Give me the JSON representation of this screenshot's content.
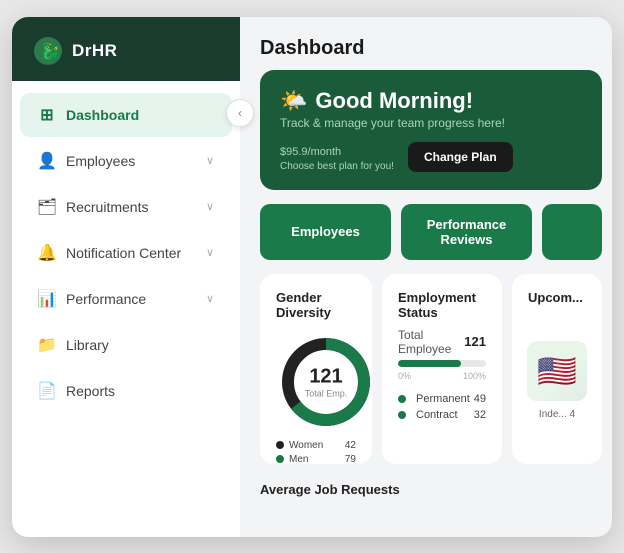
{
  "sidebar": {
    "logo": "DrHR",
    "collapse_icon": "‹",
    "items": [
      {
        "id": "dashboard",
        "label": "Dashboard",
        "icon": "⊞",
        "active": true,
        "hasChevron": false
      },
      {
        "id": "employees",
        "label": "Employees",
        "icon": "👤",
        "active": false,
        "hasChevron": true
      },
      {
        "id": "recruitments",
        "label": "Recruitments",
        "icon": "🗂",
        "active": false,
        "hasChevron": true
      },
      {
        "id": "notification-center",
        "label": "Notification Center",
        "icon": "🔔",
        "active": false,
        "hasChevron": true
      },
      {
        "id": "performance",
        "label": "Performance",
        "icon": "📊",
        "active": false,
        "hasChevron": true
      },
      {
        "id": "library",
        "label": "Library",
        "icon": "📁",
        "active": false,
        "hasChevron": false
      },
      {
        "id": "reports",
        "label": "Reports",
        "icon": "📄",
        "active": false,
        "hasChevron": false
      }
    ]
  },
  "main": {
    "title": "Dashboard",
    "greeting": {
      "emoji": "🌤️",
      "title": "Good Morning!",
      "subtitle": "Track & manage your team progress here!",
      "plan_price": "$95.9",
      "plan_period": "/month",
      "plan_cta": "Choose best plan for you!",
      "change_plan_btn": "Change Plan"
    },
    "quick_actions": [
      {
        "label": "Employees",
        "style": "solid"
      },
      {
        "label": "Performance Reviews",
        "style": "solid"
      },
      {
        "label": "",
        "style": "solid"
      }
    ],
    "gender_diversity": {
      "title": "Gender Diversity",
      "total": 121,
      "total_label": "Total Emp.",
      "women_count": 42,
      "men_count": 79,
      "women_label": "Women",
      "men_label": "Men",
      "women_color": "#1a1a1a",
      "men_color": "#1a7a4a",
      "women_pct": 35,
      "men_pct": 65
    },
    "employment_status": {
      "title": "Employment Status",
      "total_label": "Total Employee",
      "total": 121,
      "bar_pct": 72,
      "bar_label_left": "0%",
      "bar_label_right": "100%",
      "permanent_label": "Permanent",
      "permanent_count": 49,
      "contract_label": "Contract",
      "contract_count": 32,
      "dot_permanent": "#1a7a4a",
      "dot_contract": "#1a7a4a"
    },
    "upcoming": {
      "title": "Upcom...",
      "emoji": "🇺🇸",
      "item_label": "Inde...",
      "item_num": 4
    },
    "avg_jobs": {
      "title": "Average Job Requests"
    }
  },
  "colors": {
    "sidebar_bg": "#ffffff",
    "header_bg": "#1a3c2e",
    "active_nav_bg": "#e6f4ee",
    "active_nav_text": "#1a7a4a",
    "accent": "#1a7a4a",
    "card_bg": "#ffffff",
    "morning_card_bg": "#1a5c3a"
  }
}
